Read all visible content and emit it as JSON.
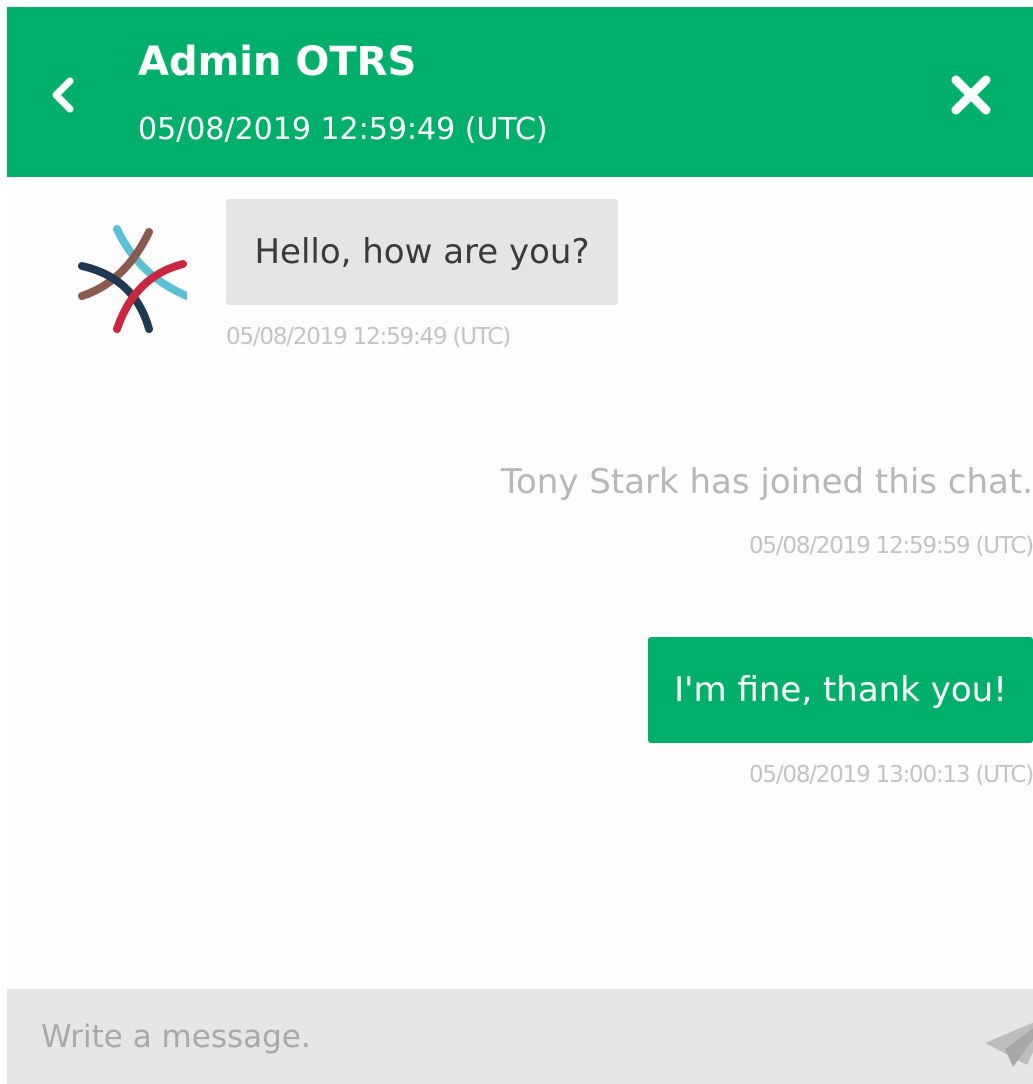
{
  "header": {
    "agent_name": "Admin OTRS",
    "timestamp": "05/08/2019 12:59:49 (UTC)",
    "back_icon": "chevron-left-icon",
    "close_icon": "close-icon"
  },
  "messages": [
    {
      "type": "incoming",
      "text": "Hello, how are you?",
      "time": "05/08/2019 12:59:49 (UTC)"
    },
    {
      "type": "system",
      "text": "Tony Stark has joined this chat.",
      "time": "05/08/2019 12:59:59 (UTC)"
    },
    {
      "type": "outgoing",
      "text": "I'm fine, thank you!",
      "time": "05/08/2019 13:00:13 (UTC)"
    }
  ],
  "composer": {
    "placeholder": "Write a message.",
    "send_icon": "paper-plane-icon"
  },
  "colors": {
    "brand": "#00b06a",
    "incoming_bubble": "#e5e5e5",
    "composer_bg": "#e6e6e6",
    "avatar_colors": [
      "#5bc0d6",
      "#8b5a4e",
      "#1e3a52",
      "#c8283f"
    ]
  }
}
